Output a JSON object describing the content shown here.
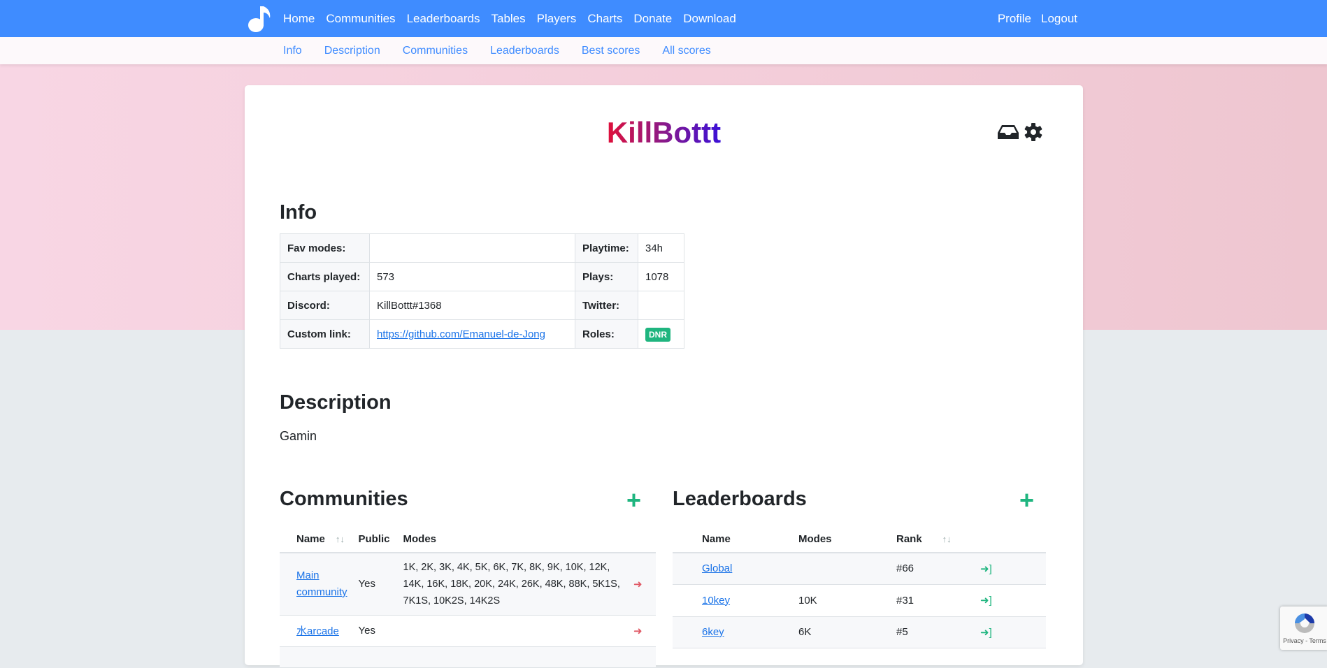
{
  "nav": {
    "items": [
      "Home",
      "Communities",
      "Leaderboards",
      "Tables",
      "Players",
      "Charts",
      "Donate",
      "Download"
    ],
    "right": [
      "Profile",
      "Logout"
    ]
  },
  "subnav": [
    "Info",
    "Description",
    "Communities",
    "Leaderboards",
    "Best scores",
    "All scores"
  ],
  "player": {
    "name": "KillBottt"
  },
  "info": {
    "heading": "Info",
    "rows": [
      {
        "l1": "Fav modes:",
        "v1": "",
        "l2": "Playtime:",
        "v2": "34h"
      },
      {
        "l1": "Charts played:",
        "v1": "573",
        "l2": "Plays:",
        "v2": "1078"
      },
      {
        "l1": "Discord:",
        "v1": "KillBottt#1368",
        "l2": "Twitter:",
        "v2": ""
      },
      {
        "l1": "Custom link:",
        "v1": "https://github.com/Emanuel-de-Jong",
        "l2": "Roles:",
        "v2": "DNR"
      }
    ]
  },
  "description": {
    "heading": "Description",
    "text": "Gamin"
  },
  "communities": {
    "heading": "Communities",
    "columns": [
      "Name",
      "Public",
      "Modes"
    ],
    "rows": [
      {
        "name": "Main community",
        "public": "Yes",
        "modes": "1K, 2K, 3K, 4K, 5K, 6K, 7K, 8K, 9K, 10K, 12K, 14K, 16K, 18K, 20K, 24K, 26K, 48K, 88K, 5K1S, 7K1S, 10K2S, 14K2S"
      },
      {
        "name": "水arcade",
        "public": "Yes",
        "modes": ""
      }
    ]
  },
  "leaderboards": {
    "heading": "Leaderboards",
    "columns": [
      "Name",
      "Modes",
      "Rank"
    ],
    "rows": [
      {
        "name": "Global",
        "modes": "",
        "rank": "#66"
      },
      {
        "name": "10key",
        "modes": "10K",
        "rank": "#31"
      },
      {
        "name": "6key",
        "modes": "6K",
        "rank": "#5"
      }
    ]
  },
  "recaptcha": {
    "text": "Privacy - Terms"
  },
  "colors": {
    "nav": "#3f8cff",
    "accent_green": "#1fb57f",
    "leave_red": "#e05a66"
  }
}
